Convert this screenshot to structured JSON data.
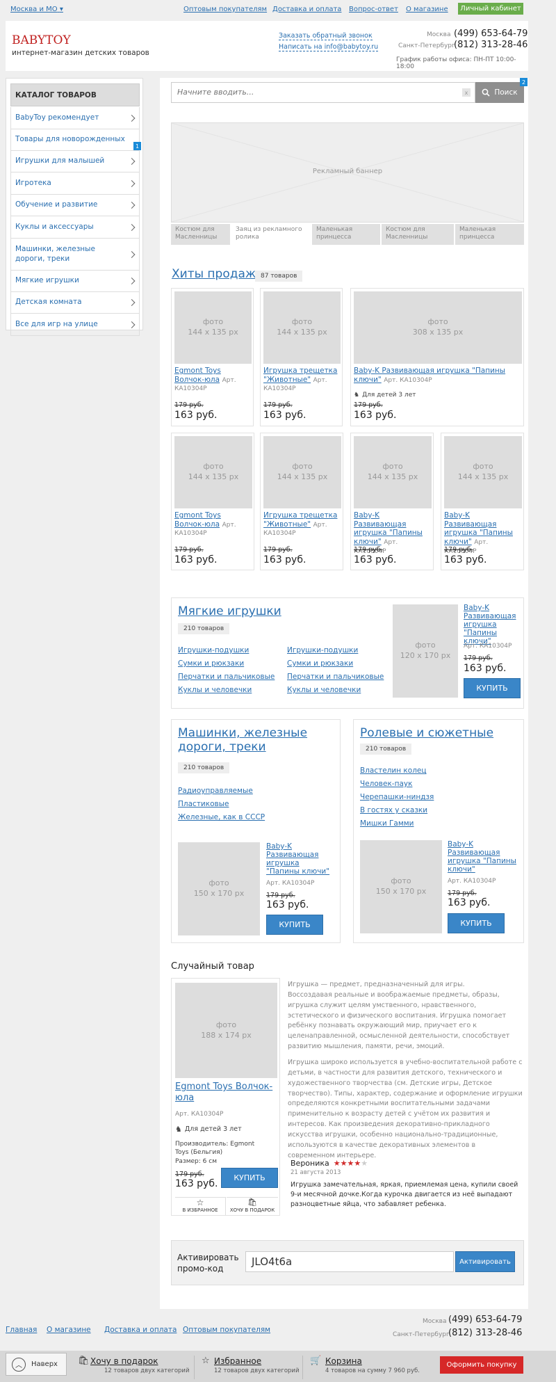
{
  "topbar": {
    "region": "Москва и МО",
    "links": [
      "Оптовым покупателям",
      "Доставка и оплата",
      "Вопрос-ответ",
      "О магазине"
    ],
    "cabinet": "Личный кабинет"
  },
  "header": {
    "logo": "BABYTOY",
    "tagline": "интернет-магазин детских товаров",
    "callback": "Заказать обратный звонок",
    "email_link": "Написать на info@babytoy.ru",
    "city1": "Москва",
    "phone1": "(499) 653-64-79",
    "city2": "Санкт-Петербург",
    "phone2": "(812) 313-28-46",
    "hours": "График работы офиса: ПН-ПТ 10:00-18:00"
  },
  "sidebar": {
    "title": "КАТАЛОГ ТОВАРОВ",
    "badge": "1",
    "items": [
      {
        "label": "BabyToy рекомендует",
        "chev": true
      },
      {
        "label": "Товары для новорожденных",
        "chev": false
      },
      {
        "label": "Игрушки для малышей",
        "chev": true
      },
      {
        "label": "Игротека",
        "chev": true
      },
      {
        "label": "Обучение и развитие",
        "chev": true
      },
      {
        "label": "Куклы и аксессуары",
        "chev": true
      },
      {
        "label": "Машинки, железные дороги, треки",
        "chev": true
      },
      {
        "label": "Мягкие игрушки",
        "chev": true
      },
      {
        "label": "Детская комната",
        "chev": true
      },
      {
        "label": "Все для игр на улице",
        "chev": true
      }
    ]
  },
  "search": {
    "placeholder": "Начните вводить...",
    "clear": "x",
    "button": "Поиск",
    "badge": "2"
  },
  "banner": {
    "label": "Рекламный баннер",
    "tabs": [
      "Костюм для Масленницы",
      "Заяц из рекламного ролика",
      "Маленькая принцесса",
      "Костюм для Масленницы",
      "Маленькая принцесса"
    ]
  },
  "hits": {
    "title": "Хиты продаж",
    "count": "87 товаров",
    "row1": [
      {
        "photo": "фото",
        "size": "144 x 135 px",
        "title": "Egmont Toys Волчок-юла",
        "art": "Арт. КА10304Р",
        "old": "179 руб.",
        "price": "163 руб."
      },
      {
        "photo": "фото",
        "size": "144 x 135 px",
        "title": "Игрушка трещетка \"Животные\"",
        "art": "Арт. КА10304Р",
        "old": "179 руб.",
        "price": "163 руб."
      },
      {
        "photo": "фото",
        "size": "308 x 135 px",
        "title": "Baby-K Развивающая игрушка \"Папины ключи\"",
        "art": "Арт. КА10304Р",
        "age": "Для детей 3 лет",
        "old": "179 руб.",
        "price": "163 руб."
      }
    ],
    "row2": [
      {
        "photo": "фото",
        "size": "144 x 135 px",
        "title": "Egmont Toys Волчок-юла",
        "art": "Арт. КА10304Р",
        "old": "179 руб.",
        "price": "163 руб."
      },
      {
        "photo": "фото",
        "size": "144 x 135 px",
        "title": "Игрушка трещетка \"Животные\"",
        "art": "Арт. КА10304Р",
        "old": "179 руб.",
        "price": "163 руб."
      },
      {
        "photo": "фото",
        "size": "144 x 135 px",
        "title": "Baby-K Развивающая игрушка \"Папины ключи\"",
        "art": "Арт. КА10304Р",
        "old": "179 руб.",
        "price": "163 руб."
      },
      {
        "photo": "фото",
        "size": "144 x 135 px",
        "title": "Baby-K Развивающая игрушка \"Папины ключи\"",
        "art": "Арт. КА10304Р",
        "old": "179 руб.",
        "price": "163 руб."
      }
    ]
  },
  "soft": {
    "title": "Мягкие игрушки",
    "count": "210 товаров",
    "links": [
      "Игрушки-подушки",
      "Сумки и рюкзаки",
      "Перчатки и пальчиковые",
      "Куклы и человечки",
      "Игрушки-подушки",
      "Сумки и рюкзаки",
      "Перчатки и пальчиковые",
      "Куклы и человечки"
    ],
    "product": {
      "photo": "фото",
      "size": "120 x 170 px",
      "title": "Baby-K Развивающая игрушка \"Папины ключи\"",
      "art": "Арт. КА10304Р",
      "old": "179 руб.",
      "price": "163 руб.",
      "buy": "КУПИТЬ"
    }
  },
  "cars": {
    "title": "Машинки, железные дороги, треки",
    "count": "210 товаров",
    "links": [
      "Радиоуправляемые",
      "Пластиковые",
      "Железные, как в СССР"
    ],
    "product": {
      "photo": "фото",
      "size": "150 x 170 px",
      "title": "Baby-K Развивающая игрушка \"Папины ключи\"",
      "art": "Арт. КА10304Р",
      "old": "179 руб.",
      "price": "163 руб.",
      "buy": "КУПИТЬ"
    }
  },
  "roles": {
    "title": "Ролевые и сюжетные игры",
    "count": "210 товаров",
    "links": [
      "Властелин колец",
      "Человек-паук",
      "Черепашки-ниндзя",
      "В гостях у сказки",
      "Мишки Гамми"
    ],
    "product": {
      "photo": "фото",
      "size": "150 x 170 px",
      "title": "Baby-K Развивающая игрушка \"Папины ключи\"",
      "art": "Арт. КА10304Р",
      "old": "179 руб.",
      "price": "163 руб.",
      "buy": "КУПИТЬ"
    }
  },
  "random": {
    "heading": "Случайный товар",
    "photo": "фото",
    "size": "188 x 174 px",
    "title": "Egmont Toys Волчок-юла",
    "art": "Арт. КА10304Р",
    "age": "Для детей 3 лет",
    "maker": "Производитель: Egmont Toys (Бельгия)",
    "dims": "Размер: 6 см",
    "old": "179 руб.",
    "price": "163 руб.",
    "buy": "КУПИТЬ",
    "fav": "В ИЗБРАННОЕ",
    "gift": "ХОЧУ В ПОДАРОК",
    "desc1": "Игрушка — предмет, предназначенный для игры.\nВоссоздавая реальные и воображаемые предметы, образы, игрушка служит целям умственного, нравственного, эстетического и физического воспитания. Игрушка помогает ребёнку познавать окружающий мир, приучает его к целенаправленной, осмысленной деятельности, способствует развитию мышления, памяти, речи, эмоций.",
    "desc2": "Игрушка широко используется в учебно-воспитательной работе с детьми, в частности для развития детского, технического и художественного творчества (см. Детские игры, Детское творчество). Типы, характер, содержание и оформление игрушки определяются конкретными воспитательными задачами применительно к возрасту детей с учётом их развития и интересов. Как произведения декоративно-прикладного искусства игрушки, особенно национально-традиционные, используются в качестве декоративных элементов в современном интерьере.",
    "review": {
      "author": "Вероника",
      "rating": 4,
      "date": "21 августа 2013",
      "text": "Игрушка замечательная, яркая, приемлемая цена, купили своей 9-и месячной дочке.Когда курочка двигается из неё выпадают разноцветные яйца, что забавляет ребенка."
    }
  },
  "promo": {
    "label": "Активировать промо-код",
    "value": "JLO4t6a",
    "button": "Активировать"
  },
  "footer": {
    "links": [
      "Главная",
      "О магазине",
      "Доставка и оплата",
      "Оптовым покупателям"
    ],
    "city1": "Москва",
    "phone1": "(499) 653-64-79",
    "city2": "Санкт-Петербург",
    "phone2": "(812) 313-28-46"
  },
  "bottombar": {
    "up": "Наверх",
    "wish_title": "Хочу в подарок",
    "wish_sub": "12 товаров двух категорий",
    "fav_title": "Избранное",
    "fav_sub": "12 товаров двух категорий",
    "cart_title": "Корзина",
    "cart_sub": "4 товаров на сумму 7 960 руб.",
    "checkout": "Оформить покупку"
  },
  "colors": {
    "accent": "#2a6fb0",
    "brand": "#c0201f",
    "cabinet": "#6aad4b",
    "checkout": "#d62828",
    "buy": "#3a86c8"
  }
}
